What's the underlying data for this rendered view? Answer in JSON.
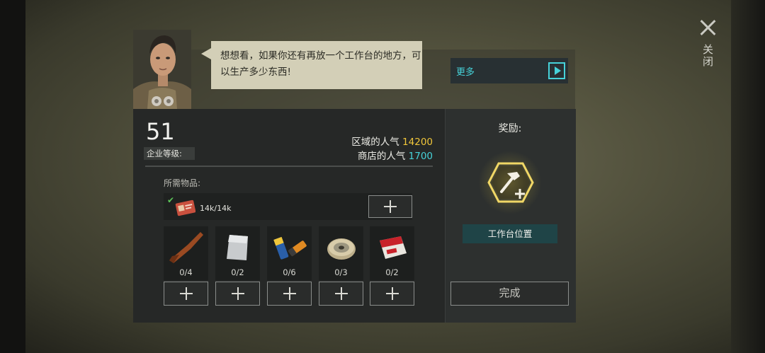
{
  "dialog": {
    "speech": "想想看，如果你还有再放一个工作台的地方，可以生产多少东西!",
    "more_label": "更多",
    "close_label": "关闭"
  },
  "company": {
    "level_value": "51",
    "level_label": "企业等级:"
  },
  "popularity": {
    "region_label": "区域的人气",
    "region_value": "14200",
    "shop_label": "商店的人气",
    "shop_value": "1700"
  },
  "requirements": {
    "label": "所需物品:",
    "main_item": {
      "icon": "id-card-icon",
      "count": "14k/14k",
      "fulfilled": true
    },
    "materials": [
      {
        "icon": "rifle-stock-icon",
        "count": "0/4"
      },
      {
        "icon": "metal-sheet-icon",
        "count": "0/2"
      },
      {
        "icon": "batteries-icon",
        "count": "0/6"
      },
      {
        "icon": "wire-spool-icon",
        "count": "0/3"
      },
      {
        "icon": "cigarette-pack-icon",
        "count": "0/2"
      }
    ]
  },
  "reward": {
    "title": "奖励:",
    "icon": "hammer-plus-icon",
    "location_button": "工作台位置"
  },
  "done_button": "完成",
  "colors": {
    "accent_cyan": "#46d2d9",
    "accent_gold": "#f0c63a",
    "check_green": "#5dc85a"
  }
}
